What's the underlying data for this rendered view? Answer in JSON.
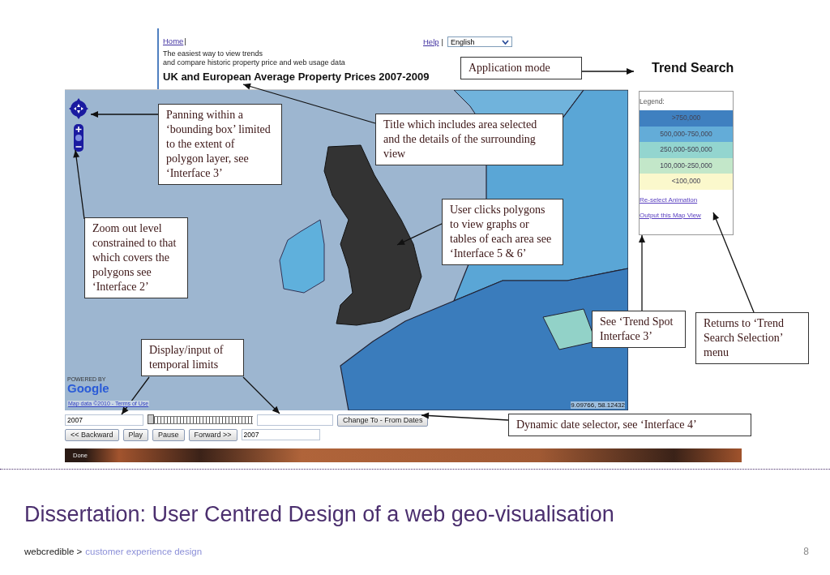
{
  "web_app": {
    "header": {
      "home_link": "Home",
      "home_separator": "|",
      "tagline": [
        "The easiest way to view trends",
        "and compare historic property price and web usage data"
      ],
      "title": "UK and European Average Property Prices 2007-2009",
      "help_link": "Help",
      "help_separator": "|",
      "language_select": "English"
    },
    "mode_label": "Trend Search",
    "map": {
      "logo_caption": "POWERED BY",
      "logo": "Google",
      "attribution": "Map data ©2010 - Terms of Use",
      "coordinates": "9.09766, 58.12432"
    },
    "legend": {
      "title": "Legend:",
      "items": [
        {
          "label": ">750,000",
          "color": "#3f80c0"
        },
        {
          "label": "500,000-750,000",
          "color": "#63acd8"
        },
        {
          "label": "250,000-500,000",
          "color": "#93d5cf"
        },
        {
          "label": "100,000-250,000",
          "color": "#c3e7c9"
        },
        {
          "label": "<100,000",
          "color": "#fbf8cc"
        }
      ]
    },
    "links": [
      "Re-select Animation",
      "Output this Map View"
    ],
    "date_controls": {
      "from_date": "2007",
      "slider": {
        "level": 0
      },
      "change_button": "Change To - From Dates",
      "buttons": [
        "<< Backward",
        "Play",
        "Pause",
        "Forward >>"
      ],
      "current_date": "2007"
    },
    "status_bar": "Done"
  },
  "annotations": [
    "Application mode",
    "Panning within a ‘bounding box’ limited to the extent of polygon layer, see ‘Interface 3’",
    "Title which includes area selected and the details of the surrounding view",
    "User clicks polygons to view graphs or tables of each area see ‘Interface 5 & 6’",
    "Zoom out level constrained to that which covers the polygons see ‘Interface 2’",
    "See ‘Trend Spot Interface 3’",
    "Returns to ‘Trend Search Selection’ menu",
    "Display/input of temporal limits",
    "Dynamic date selector, see ‘Interface 4’"
  ],
  "slide": {
    "title": "Dissertation: User Centred Design of a web geo-visualisation",
    "footer_brand": "webcredible >",
    "footer_section": "customer experience design",
    "page_number": "8"
  }
}
